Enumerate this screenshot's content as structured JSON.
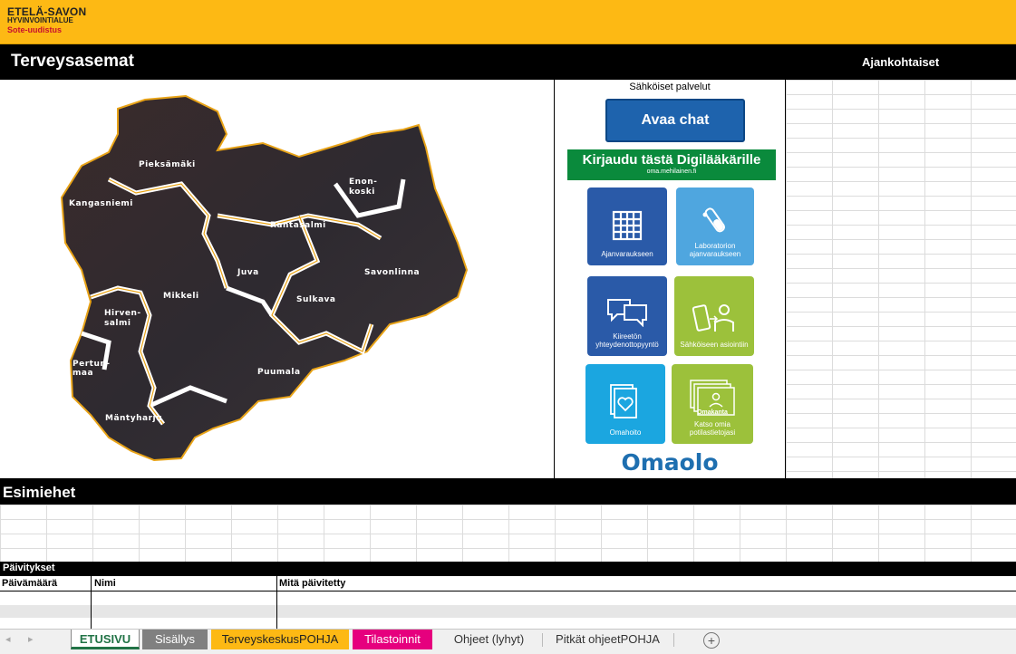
{
  "logo": {
    "line1": "ETELÄ-SAVON",
    "line2": "HYVINVOINTIALUE",
    "line3": "Sote-uudistus"
  },
  "header": {
    "title": "Terveysasemat",
    "news_label": "Ajankohtaiset"
  },
  "map": {
    "labels": [
      "Pieksämäki",
      "Kangasniemi",
      "Enon-",
      "koski",
      "Rantasalmi",
      "Juva",
      "Savonlinna",
      "Mikkeli",
      "Sulkava",
      "Hirven-",
      "salmi",
      "Pertun-",
      "maa",
      "Puumala",
      "Mäntyharju"
    ]
  },
  "services": {
    "heading": "Sähköiset palvelut",
    "chat_button": "Avaa chat",
    "digi_button": "Kirjaudu tästä Digilääkärille",
    "digi_sub": "oma.mehilainen.fi",
    "tiles": [
      {
        "label": "Ajanvaraukseen",
        "icon": "calendar-grid-icon",
        "color": "#2a5aa8"
      },
      {
        "label": "Laboratorion ajanvaraukseen",
        "icon": "test-tube-icon",
        "color": "#4fa6df"
      },
      {
        "label": "Kiireetön yhteydenottopyyntö",
        "icon": "chat-bubbles-icon",
        "color": "#2a5aa8"
      },
      {
        "label": "Sähköiseen asiointiin",
        "icon": "phone-person-icon",
        "color": "#9cc13b"
      },
      {
        "label": "Omahoito",
        "icon": "heart-cards-icon",
        "color": "#1ba6e0"
      },
      {
        "label": "Katso omia potilastietojasi",
        "icon": "omakanta-folder-icon",
        "color": "#9cc13b"
      }
    ],
    "tile_omakanta_text": "Omakanta",
    "brand": "Omaolo"
  },
  "managers": {
    "title": "Esimiehet"
  },
  "updates": {
    "title": "Päivitykset",
    "columns": [
      "Päivämäärä",
      "Nimi",
      "Mitä päivitetty"
    ]
  },
  "tabs": [
    {
      "label": "ETUSIVU",
      "active": true,
      "color": "#ffffff"
    },
    {
      "label": "Sisällys",
      "color": "#808080"
    },
    {
      "label": "TerveyskeskusPOHJA",
      "color": "#fdb914"
    },
    {
      "label": "Tilastoinnit",
      "color": "#e6007e"
    },
    {
      "label": "Ohjeet (lyhyt)",
      "color": ""
    },
    {
      "label": "Pitkät ohjeetPOHJA",
      "color": ""
    }
  ],
  "colors": {
    "brand_yellow": "#fdb914",
    "black": "#000000",
    "green": "#0a8a3c"
  }
}
